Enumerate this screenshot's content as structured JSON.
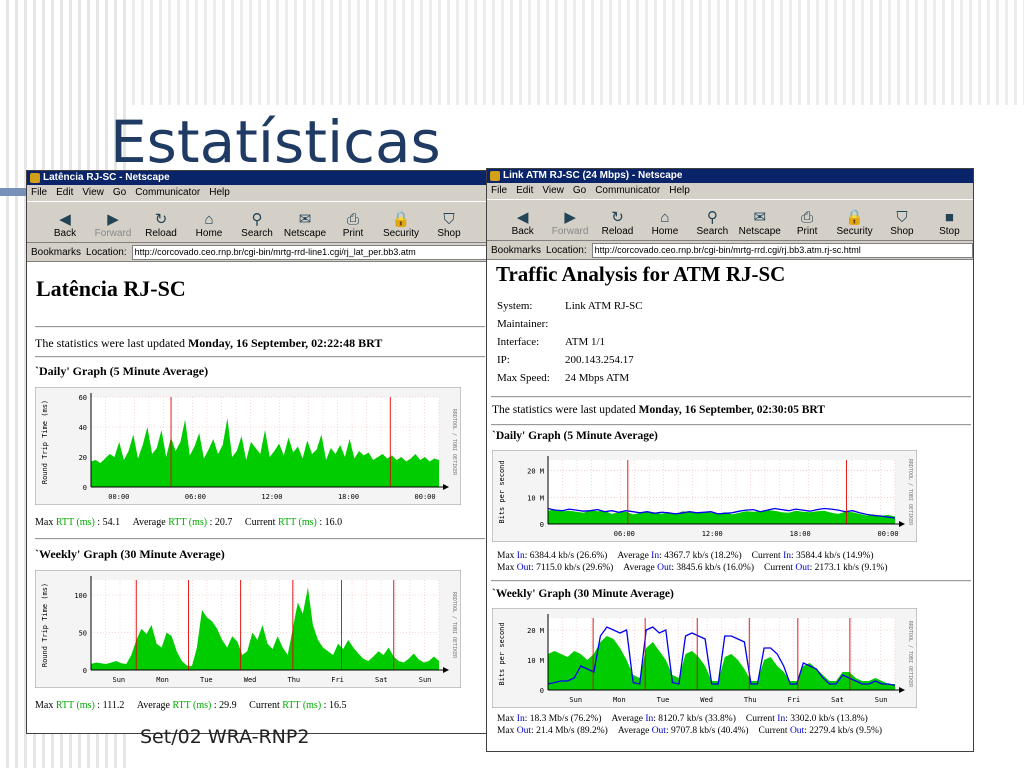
{
  "slide": {
    "title": "Estatísticas",
    "footer": "Set/02 WRA-RNP2"
  },
  "left_window": {
    "title": "Latência RJ-SC - Netscape",
    "menu": [
      "File",
      "Edit",
      "View",
      "Go",
      "Communicator",
      "Help"
    ],
    "toolbar": [
      "Back",
      "Forward",
      "Reload",
      "Home",
      "Search",
      "Netscape",
      "Print",
      "Security",
      "Shop"
    ],
    "bookmarks": "Bookmarks",
    "location_label": "Location:",
    "url": "http://corcovado.ceo.rnp.br/cgi-bin/mrtg-rrd-line1.cgi/rj_lat_per.bb3.atm",
    "heading": "Latência RJ-SC",
    "updated_prefix": "The statistics were last updated ",
    "updated_date": "Monday, 16 September, 02:22:48 BRT",
    "daily_title": "`Daily' Graph (5 Minute Average)",
    "daily_stats": {
      "max": "54.1",
      "avg": "20.7",
      "cur": "16.0"
    },
    "weekly_title": "`Weekly' Graph (30 Minute Average)",
    "weekly_stats": {
      "max": "111.2",
      "avg": "29.9",
      "cur": "16.5"
    },
    "stat_labels": {
      "max": "Max ",
      "avg": "Average ",
      "cur": "Current ",
      "rtt": "RTT (ms)",
      "sep": " : "
    }
  },
  "right_window": {
    "title": "Link ATM RJ-SC (24 Mbps) - Netscape",
    "menu": [
      "File",
      "Edit",
      "View",
      "Go",
      "Communicator",
      "Help"
    ],
    "toolbar": [
      "Back",
      "Forward",
      "Reload",
      "Home",
      "Search",
      "Netscape",
      "Print",
      "Security",
      "Shop",
      "Stop"
    ],
    "bookmarks": "Bookmarks",
    "location_label": "Location:",
    "url": "http://corcovado.ceo.rnp.br/cgi-bin/mrtg-rrd.cgi/rj.bb3.atm.rj-sc.html",
    "heading": "Traffic Analysis for ATM RJ-SC",
    "info": [
      {
        "k": "System:",
        "v": "Link ATM RJ-SC"
      },
      {
        "k": "Maintainer:",
        "v": ""
      },
      {
        "k": "Interface:",
        "v": "ATM 1/1"
      },
      {
        "k": "IP:",
        "v": "200.143.254.17"
      },
      {
        "k": "Max Speed:",
        "v": "24 Mbps ATM"
      }
    ],
    "updated_prefix": "The statistics were last updated ",
    "updated_date": "Monday, 16 September, 02:30:05 BRT",
    "daily_title": "`Daily' Graph (5 Minute Average)",
    "daily_stats": {
      "in": {
        "max": "6384.4 kb/s (26.6%)",
        "avg": "4367.7 kb/s (18.2%)",
        "cur": "3584.4 kb/s (14.9%)"
      },
      "out": {
        "max": "7115.0 kb/s (29.6%)",
        "avg": "3845.6 kb/s (16.0%)",
        "cur": "2173.1 kb/s (9.1%)"
      }
    },
    "weekly_title": "`Weekly' Graph (30 Minute Average)",
    "weekly_stats": {
      "in": {
        "max": "18.3 Mb/s (76.2%)",
        "avg": "8120.7 kb/s (33.8%)",
        "cur": "3302.0 kb/s (13.8%)"
      },
      "out": {
        "max": "21.4 Mb/s (89.2%)",
        "avg": "9707.8 kb/s (40.4%)",
        "cur": "2279.4 kb/s (9.5%)"
      }
    },
    "stat_labels": {
      "max": "Max ",
      "avg": "Average ",
      "cur": "Current ",
      "in": "In",
      "out": "Out",
      "sep": ": "
    }
  },
  "chart_data": [
    {
      "id": "lat_daily",
      "type": "area",
      "ylabel": "Round Trip Time (ms)",
      "watermark": "RRDTOOL / TOBI OETIKER",
      "ylim": [
        0,
        60
      ],
      "yticks": [
        0,
        20,
        40,
        60
      ],
      "xticks": [
        "00:00",
        "06:00",
        "12:00",
        "18:00",
        "00:00"
      ],
      "series": [
        {
          "name": "RTT",
          "color": "#00cc00",
          "values": [
            17,
            18,
            16,
            19,
            22,
            20,
            30,
            18,
            24,
            35,
            19,
            28,
            40,
            22,
            26,
            38,
            20,
            33,
            24,
            30,
            45,
            21,
            27,
            36,
            19,
            25,
            32,
            22,
            28,
            46,
            20,
            24,
            34,
            18,
            30,
            26,
            22,
            38,
            20,
            24,
            29,
            21,
            33,
            23,
            27,
            19,
            31,
            22,
            25,
            35,
            18,
            26,
            22,
            28,
            20,
            32,
            19,
            24,
            21,
            23,
            18,
            20,
            22,
            19,
            21,
            18,
            20,
            17,
            19,
            22,
            18,
            20,
            17,
            19,
            18
          ]
        }
      ]
    },
    {
      "id": "lat_weekly",
      "type": "area",
      "ylabel": "Round Trip Time (ms)",
      "watermark": "RRDTOOL / TOBI OETIKER",
      "ylim": [
        0,
        120
      ],
      "yticks": [
        0,
        50,
        100
      ],
      "xticks": [
        "Sun",
        "Mon",
        "Tue",
        "Wed",
        "Thu",
        "Fri",
        "Sat",
        "Sun"
      ],
      "series": [
        {
          "name": "RTT",
          "color": "#00cc00",
          "values": [
            8,
            10,
            9,
            8,
            10,
            12,
            9,
            8,
            20,
            40,
            55,
            48,
            60,
            35,
            30,
            50,
            45,
            25,
            12,
            6,
            5,
            30,
            80,
            70,
            65,
            55,
            40,
            30,
            45,
            38,
            20,
            25,
            50,
            40,
            60,
            35,
            28,
            45,
            30,
            20,
            55,
            90,
            75,
            110,
            60,
            40,
            30,
            25,
            20,
            35,
            28,
            40,
            30,
            22,
            15,
            12,
            18,
            25,
            20,
            30,
            18,
            12,
            10,
            15,
            22,
            14,
            10,
            12,
            18,
            12
          ]
        }
      ]
    },
    {
      "id": "atm_daily",
      "type": "area",
      "ylabel": "Bits per second",
      "watermark": "RRDTOOL / TOBI OETIKER",
      "ylim": [
        0,
        24
      ],
      "yticks": [
        0,
        10,
        20
      ],
      "ytick_labels": [
        "0",
        "10 M",
        "20 M"
      ],
      "xticks": [
        "06:00",
        "12:00",
        "18:00",
        "00:00"
      ],
      "x_offset_first": 0.22,
      "series": [
        {
          "name": "In",
          "color": "#00cc00",
          "values": [
            5,
            5.5,
            4.8,
            5,
            4.6,
            4.2,
            5.2,
            4.8,
            5,
            3.8,
            4.4,
            4.6,
            3.6,
            4.2,
            4.8,
            4.4,
            3.8,
            4.2,
            3.6,
            4.8,
            4.4,
            4,
            4.6,
            4.2,
            3.8,
            4.4,
            3.6,
            4.2,
            4.8,
            4.6,
            4.8,
            5.2,
            5,
            4.4,
            4.2,
            5,
            4.6,
            4.4,
            4.8,
            5,
            4.2,
            3.8,
            4.6,
            4.4,
            3.8,
            3.2,
            3.6,
            3,
            3.4,
            2.8
          ]
        },
        {
          "name": "Out",
          "color": "#0000ee",
          "values": [
            5.8,
            5.2,
            5,
            5.6,
            5.2,
            4.8,
            5,
            5.4,
            4.6,
            5,
            4.4,
            5,
            4.6,
            4.2,
            4.6,
            4,
            4.4,
            4.2,
            3.8,
            4.2,
            4.6,
            4.2,
            4.4,
            4.6,
            3.8,
            4,
            4.2,
            4.8,
            5.2,
            5.4,
            4.6,
            5.2,
            5.8,
            5.4,
            5,
            5.6,
            5.2,
            4.8,
            5.4,
            5.8,
            5.6,
            5.2,
            4.6,
            5,
            4.2,
            3.6,
            3.2,
            3,
            2.6,
            2.2
          ]
        }
      ]
    },
    {
      "id": "atm_weekly",
      "type": "area",
      "ylabel": "Bits per second",
      "watermark": "RRDTOOL / TOBI OETIKER",
      "ylim": [
        0,
        24
      ],
      "yticks": [
        0,
        10,
        20
      ],
      "ytick_labels": [
        "0",
        "10 M",
        "20 M"
      ],
      "xticks": [
        "Sun",
        "Mon",
        "Tue",
        "Wed",
        "Thu",
        "Fri",
        "Sat",
        "Sun"
      ],
      "series": [
        {
          "name": "In",
          "color": "#00cc00",
          "values": [
            12,
            13,
            12,
            11,
            13,
            12,
            10,
            12,
            16,
            18,
            17,
            14,
            10,
            5,
            4,
            14,
            16,
            13,
            10,
            5,
            4,
            12,
            13,
            11,
            8,
            3,
            3,
            11,
            12,
            10,
            7,
            3,
            3,
            10,
            11,
            8,
            6,
            3,
            3,
            8,
            9,
            7,
            5,
            3,
            3,
            6,
            6,
            4,
            3,
            3,
            4,
            3,
            2,
            2
          ]
        },
        {
          "name": "Out",
          "color": "#0000ee",
          "values": [
            2,
            2.5,
            3,
            3,
            4,
            8,
            7,
            6,
            18,
            21,
            20,
            19,
            20,
            2.5,
            2,
            20,
            21,
            19,
            20,
            2.5,
            2,
            18,
            19,
            18,
            17,
            2,
            2,
            18,
            18,
            17,
            16,
            2,
            2,
            14,
            14,
            12,
            8,
            2,
            2,
            9,
            8,
            7,
            4,
            2,
            2,
            5,
            4,
            3,
            2,
            2,
            3,
            2,
            2,
            1.5
          ]
        }
      ]
    }
  ]
}
